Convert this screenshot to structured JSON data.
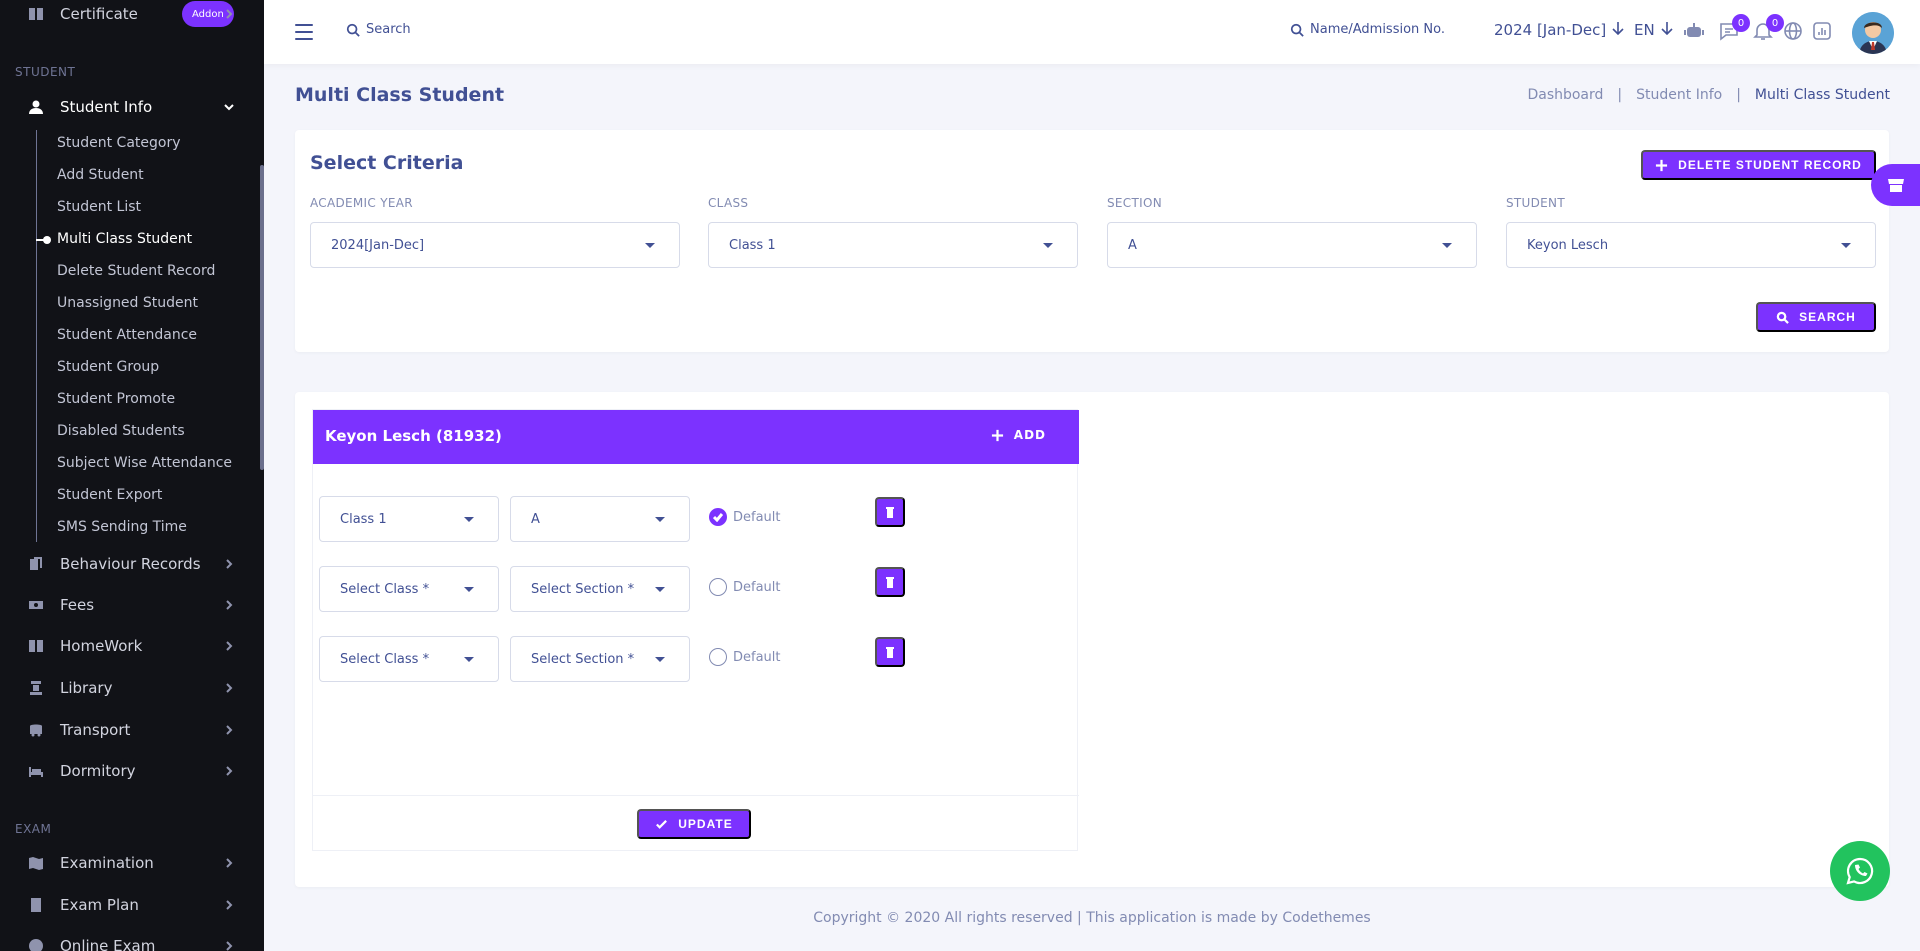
{
  "sidebar": {
    "top_item": {
      "label": "Certificate",
      "badge": "Addon"
    },
    "section_student": "STUDENT",
    "student_info": {
      "label": "Student Info"
    },
    "submenu": [
      "Student Category",
      "Add Student",
      "Student List",
      "Multi Class Student",
      "Delete Student Record",
      "Unassigned Student",
      "Student Attendance",
      "Student Group",
      "Student Promote",
      "Disabled Students",
      "Subject Wise Attendance",
      "Student Export",
      "SMS Sending Time"
    ],
    "menu": [
      {
        "label": "Behaviour Records",
        "icon": "records-icon"
      },
      {
        "label": "Fees",
        "icon": "fees-icon"
      },
      {
        "label": "HomeWork",
        "icon": "homework-icon"
      },
      {
        "label": "Library",
        "icon": "library-icon"
      },
      {
        "label": "Transport",
        "icon": "transport-icon"
      },
      {
        "label": "Dormitory",
        "icon": "dormitory-icon"
      }
    ],
    "section_exam": "EXAM",
    "exam_menu": [
      {
        "label": "Examination",
        "icon": "examination-icon"
      },
      {
        "label": "Exam Plan",
        "icon": "exam-plan-icon"
      },
      {
        "label": "Online Exam",
        "icon": "online-exam-icon"
      }
    ]
  },
  "header": {
    "search_label": "Search",
    "student_search_label": "Name/Admission No.",
    "academic_year": "2024 [Jan-Dec]",
    "language": "EN",
    "chat_count": "0",
    "notification_count": "0"
  },
  "page": {
    "title": "Multi Class Student",
    "breadcrumb": [
      "Dashboard",
      "Student Info",
      "Multi Class Student"
    ]
  },
  "criteria": {
    "title": "Select Criteria",
    "delete_button": "DELETE STUDENT RECORD",
    "search_button": "SEARCH",
    "fields": [
      {
        "label": "ACADEMIC YEAR",
        "value": "2024[Jan-Dec]"
      },
      {
        "label": "CLASS",
        "value": "Class 1"
      },
      {
        "label": "SECTION",
        "value": "A"
      },
      {
        "label": "STUDENT",
        "value": "Keyon Lesch"
      }
    ]
  },
  "student_record": {
    "name": "Keyon Lesch (81932)",
    "add_label": "ADD",
    "update_label": "UPDATE",
    "rows": [
      {
        "class": "Class 1",
        "section": "A",
        "default_label": "Default",
        "is_default": true
      },
      {
        "class": "Select Class *",
        "section": "Select Section *",
        "default_label": "Default",
        "is_default": false
      },
      {
        "class": "Select Class *",
        "section": "Select Section *",
        "default_label": "Default",
        "is_default": false
      }
    ]
  },
  "footer": {
    "text": "Copyright © 2020 All rights reserved | This application is made by Codethemes"
  },
  "colors": {
    "accent": "#7c32ff",
    "sidebar_bg": "#111217",
    "text_primary": "#415094",
    "whatsapp": "#22c35e"
  }
}
